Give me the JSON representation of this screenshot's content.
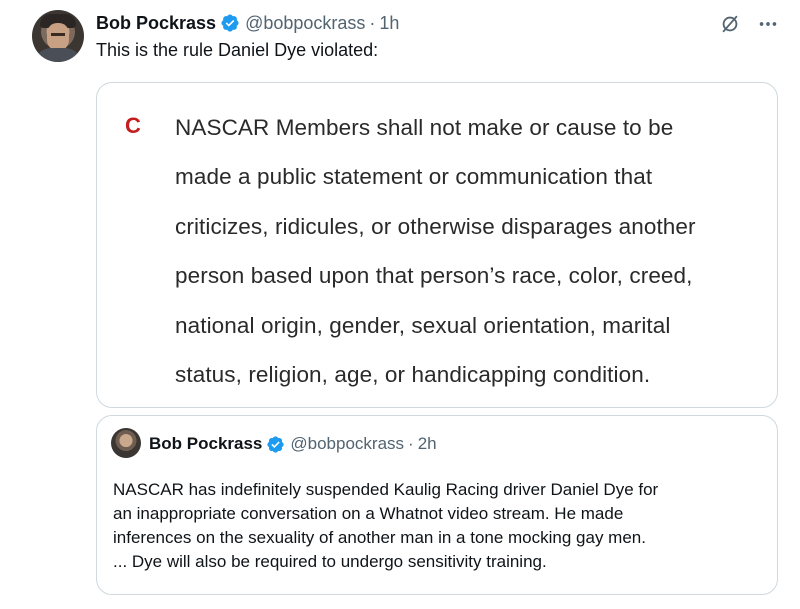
{
  "tweet": {
    "author_name": "Bob Pockrass",
    "handle": "@bobpockrass",
    "separator": "·",
    "time": "1h",
    "text": "This is the rule Daniel Dye violated:"
  },
  "actions": {
    "grok_icon": "slashed-circle-icon",
    "more_icon": "more-horizontal-icon"
  },
  "rule_image": {
    "letter": "C",
    "lines": [
      "NASCAR Members shall not make or cause to be",
      "made a public statement or communication that",
      "criticizes, ridicules, or otherwise disparages another",
      "person based upon that person’s race, color, creed,",
      "national origin, gender, sexual orientation, marital",
      "status, religion, age, or handicapping condition."
    ]
  },
  "quoted_tweet": {
    "author_name": "Bob Pockrass",
    "handle": "@bobpockrass",
    "separator": "·",
    "time": "2h",
    "lines": [
      "NASCAR has indefinitely suspended Kaulig Racing driver Daniel Dye for",
      "an inappropriate conversation on a Whatnot video stream. He made",
      "inferences on the sexuality of another man in a tone mocking gay men.",
      "... Dye will also be required to undergo sensitivity training."
    ]
  },
  "colors": {
    "verified": "#1d9bf0",
    "secondary_text": "#536471",
    "border": "#cfd9de",
    "rule_letter": "#c41e1e"
  }
}
